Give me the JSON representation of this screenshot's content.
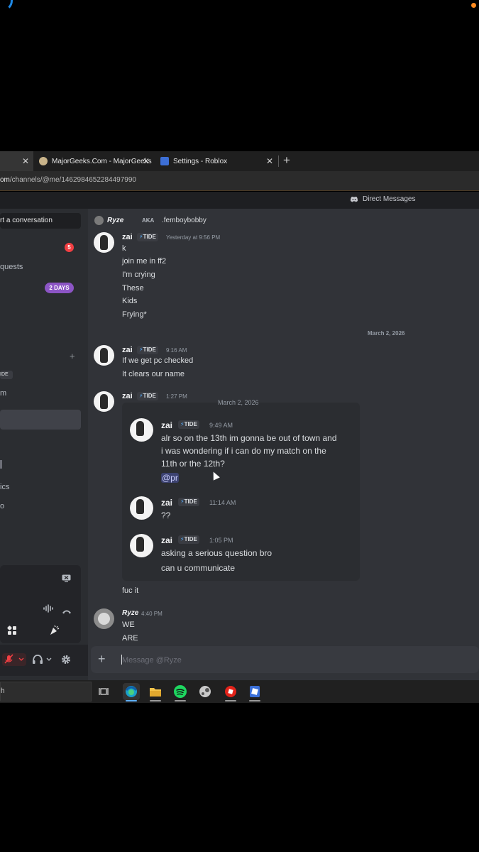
{
  "browser": {
    "tabs": [
      {
        "title": "",
        "active": true
      },
      {
        "title": "MajorGeeks.Com - MajorGeeks"
      },
      {
        "title": "Settings - Roblox"
      }
    ],
    "new_tab": "+",
    "close": "✕",
    "url_domain": "om",
    "url_path": "/channels/@me/1462984652284497990"
  },
  "discord": {
    "top_title": "Direct Messages",
    "sidebar": {
      "start_conversation": "rt a conversation",
      "friends_badge": "5",
      "message_requests": "quests",
      "nitro_badge": "2 DAYS",
      "add_dm": "+",
      "tide_tag": "IDE",
      "dm_item_1": "m",
      "item_ics": "ics",
      "item_o": "o"
    },
    "header": {
      "name": "Ryze",
      "aka": "AKA",
      "nickname": ".femboybobby"
    },
    "messages": [
      {
        "author": "zai",
        "tag": "TIDE",
        "time": "Yesterday at 9:56 PM",
        "lines": [
          "k",
          "join me in ff2",
          "I'm crying",
          "These",
          "Kids",
          "Frying*"
        ]
      },
      {
        "date_divider": "March 2, 2026"
      },
      {
        "author": "zai",
        "tag": "TIDE",
        "time": "9:16 AM",
        "lines": [
          "If we get pc checked",
          "It clears our name"
        ]
      },
      {
        "author": "zai",
        "tag": "TIDE",
        "time": "1:27 PM"
      },
      {
        "author": "Ryze",
        "time": "4:40 PM",
        "lines": [
          "WE",
          "ARE"
        ]
      }
    ],
    "forwarded": {
      "date": "March 2, 2026",
      "items": [
        {
          "author": "zai",
          "tag": "TIDE",
          "time": "9:49 AM",
          "lines": [
            "alr so on the 13th im gonna be out of town and",
            "i was wondering if i can do my match on the",
            "11th or the 12th?"
          ],
          "mention": "@pr"
        },
        {
          "author": "zai",
          "tag": "TIDE",
          "time": "11:14 AM",
          "lines": [
            "??"
          ]
        },
        {
          "author": "zai",
          "tag": "TIDE",
          "time": "1:05 PM",
          "lines": [
            "asking a serious question bro",
            "can u communicate"
          ]
        }
      ]
    },
    "after_forward": "fuc it",
    "input": {
      "placeholder": "Message @Ryze",
      "value": ""
    },
    "tag_icon": "⚡"
  },
  "taskbar": {
    "search_text": "h",
    "apps": [
      "task-view",
      "edge",
      "file-explorer",
      "spotify",
      "steam",
      "roblox-icon-red",
      "roblox-studio"
    ]
  },
  "colors": {
    "discord_bg": "#313338",
    "sidebar_bg": "#2b2d31",
    "mention_bg": "#3c4270",
    "nitro_purple": "#8c55c5",
    "badge_red": "#f23f43"
  }
}
